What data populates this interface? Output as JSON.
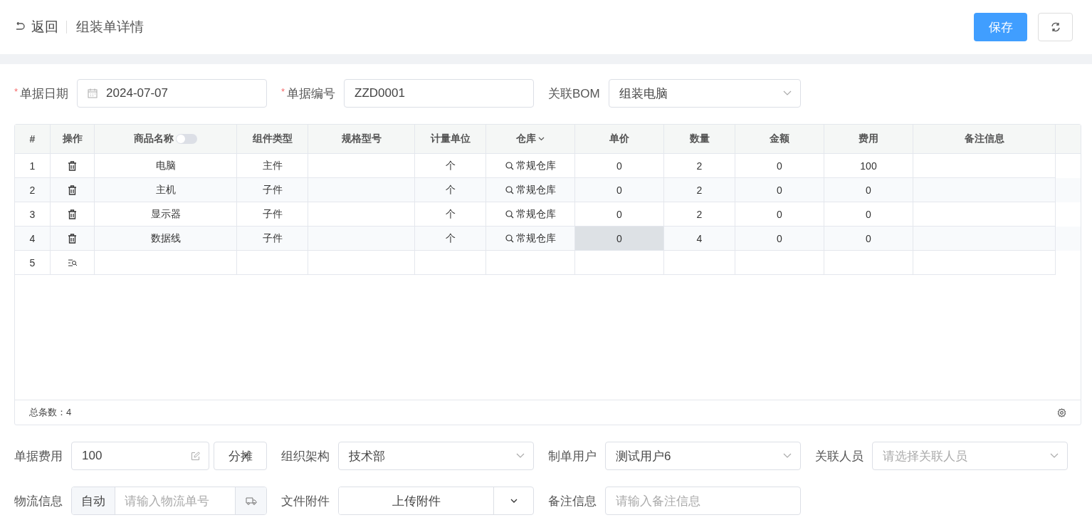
{
  "header": {
    "back_label": "返回",
    "title": "组装单详情",
    "save_button": "保存"
  },
  "form_top": [
    {
      "kind": "date",
      "required_mark": "*",
      "label": "单据日期",
      "value": "2024-07-07"
    },
    {
      "kind": "text",
      "required_mark": "*",
      "label": "单据编号",
      "value": "ZZD0001"
    },
    {
      "kind": "select",
      "label": "关联BOM",
      "value": "组装电脑"
    }
  ],
  "table": {
    "columns": [
      {
        "label": "#",
        "kind": "plain"
      },
      {
        "label": "操作",
        "kind": "plain"
      },
      {
        "label": "商品名称",
        "kind": "toggle",
        "switch_on": false
      },
      {
        "label": "组件类型",
        "kind": "plain"
      },
      {
        "label": "规格型号",
        "kind": "plain"
      },
      {
        "label": "计量单位",
        "kind": "plain"
      },
      {
        "label": "仓库",
        "kind": "dropdown"
      },
      {
        "label": "单价",
        "kind": "plain"
      },
      {
        "label": "数量",
        "kind": "plain"
      },
      {
        "label": "金额",
        "kind": "plain"
      },
      {
        "label": "费用",
        "kind": "plain"
      },
      {
        "label": "备注信息",
        "kind": "plain"
      }
    ],
    "rows": [
      {
        "kind": "item",
        "number": "1",
        "name": "电脑",
        "type": "主件",
        "unit": "个",
        "warehouse": "常规仓库",
        "price": "0",
        "qty": "2",
        "amount": "0",
        "fee": "100",
        "price_selected": false
      },
      {
        "kind": "item",
        "number": "2",
        "name": "主机",
        "type": "子件",
        "unit": "个",
        "warehouse": "常规仓库",
        "price": "0",
        "qty": "2",
        "amount": "0",
        "fee": "0",
        "price_selected": false
      },
      {
        "kind": "item",
        "number": "3",
        "name": "显示器",
        "type": "子件",
        "unit": "个",
        "warehouse": "常规仓库",
        "price": "0",
        "qty": "2",
        "amount": "0",
        "fee": "0",
        "price_selected": false
      },
      {
        "kind": "item",
        "number": "4",
        "name": "数据线",
        "type": "子件",
        "unit": "个",
        "warehouse": "常规仓库",
        "price": "0",
        "qty": "4",
        "amount": "0",
        "fee": "0",
        "price_selected": true
      },
      {
        "kind": "add",
        "number": "5"
      }
    ],
    "total": "总条数：4"
  },
  "form_bottom": [
    {
      "kind": "fee",
      "label": "单据费用",
      "value": "100",
      "button": "分摊"
    },
    {
      "kind": "select",
      "label": "组织架构",
      "value": "技术部"
    },
    {
      "kind": "select",
      "label": "制单用户",
      "value": "测试用户6"
    },
    {
      "kind": "select",
      "label": "关联人员",
      "placeholder": "请选择关联人员"
    },
    {
      "kind": "logistics",
      "label": "物流信息",
      "prefix": "自动",
      "placeholder": "请输入物流单号"
    },
    {
      "kind": "upload",
      "label": "文件附件",
      "button": "上传附件"
    },
    {
      "kind": "text",
      "label": "备注信息",
      "placeholder": "请输入备注信息"
    }
  ]
}
